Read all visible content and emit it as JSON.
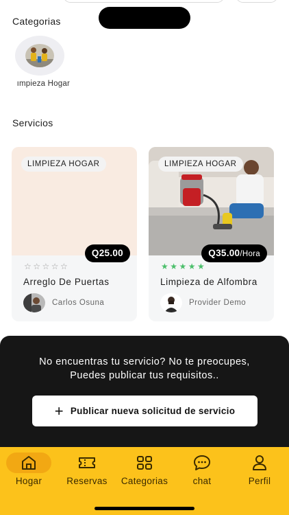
{
  "categories_section": {
    "title": "Categorias",
    "items": [
      {
        "label": "ımpieza Hogar"
      }
    ]
  },
  "services_section": {
    "title": "Servicios",
    "cards": [
      {
        "category": "LIMPIEZA HOGAR",
        "price": "Q25.00",
        "price_unit": "",
        "rating": 0,
        "stars": "☆☆☆☆☆",
        "name": "Arreglo De Puertas",
        "provider": "Carlos Osuna"
      },
      {
        "category": "LIMPIEZA HOGAR",
        "price": "Q35.00",
        "price_unit": "/Hora",
        "rating": 5,
        "stars": "★★★★★",
        "name": "Limpieza de Alfombra",
        "provider": "Provider Demo"
      }
    ]
  },
  "promo": {
    "line1": "No encuentras tu servicio? No te preocupes,",
    "line2": "Puedes publicar tus requisitos..",
    "button_label": "Publicar nueva solicitud de servicio"
  },
  "bottom_nav": {
    "items": [
      {
        "label": "Hogar",
        "icon": "home-icon",
        "active": true
      },
      {
        "label": "Reservas",
        "icon": "ticket-icon",
        "active": false
      },
      {
        "label": "Categorias",
        "icon": "grid-icon",
        "active": false
      },
      {
        "label": "chat",
        "icon": "chat-icon",
        "active": false
      },
      {
        "label": "Perfil",
        "icon": "user-icon",
        "active": false
      }
    ]
  },
  "colors": {
    "accent": "#fcc21b",
    "active_pill": "#f2a813",
    "dark_panel": "#161616",
    "star_green": "#4bbf6b"
  }
}
